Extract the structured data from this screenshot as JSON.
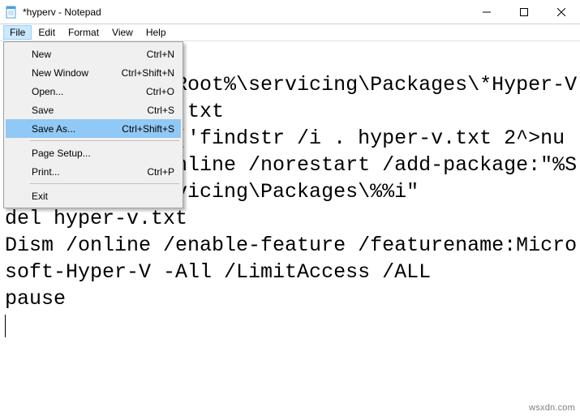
{
  "window": {
    "title": "*hyperv - Notepad"
  },
  "menubar": {
    "items": [
      "File",
      "Edit",
      "Format",
      "View",
      "Help"
    ],
    "openIndex": 0
  },
  "fileMenu": {
    "items": [
      {
        "label": "New",
        "shortcut": "Ctrl+N",
        "type": "item"
      },
      {
        "label": "New Window",
        "shortcut": "Ctrl+Shift+N",
        "type": "item"
      },
      {
        "label": "Open...",
        "shortcut": "Ctrl+O",
        "type": "item"
      },
      {
        "label": "Save",
        "shortcut": "Ctrl+S",
        "type": "item"
      },
      {
        "label": "Save As...",
        "shortcut": "Ctrl+Shift+S",
        "type": "item",
        "highlight": true
      },
      {
        "type": "sep"
      },
      {
        "label": "Page Setup...",
        "shortcut": "",
        "type": "item"
      },
      {
        "label": "Print...",
        "shortcut": "Ctrl+P",
        "type": "item"
      },
      {
        "type": "sep"
      },
      {
        "label": "Exit",
        "shortcut": "",
        "type": "item"
      }
    ]
  },
  "editor": {
    "text": "pushd \"%~dp0\"\ndir /b %SystemRoot%\\servicing\\Packages\\*Hyper-V*.mum >hyper-v.txt\nfor /f %%i in ('findstr /i . hyper-v.txt 2^>nul') do dism /online /norestart /add-package:\"%SystemRoot%\\servicing\\Packages\\%%i\"\ndel hyper-v.txt\nDism /online /enable-feature /featurename:Microsoft-Hyper-V -All /LimitAccess /ALL\npause"
  },
  "watermark": "wsxdn.com"
}
